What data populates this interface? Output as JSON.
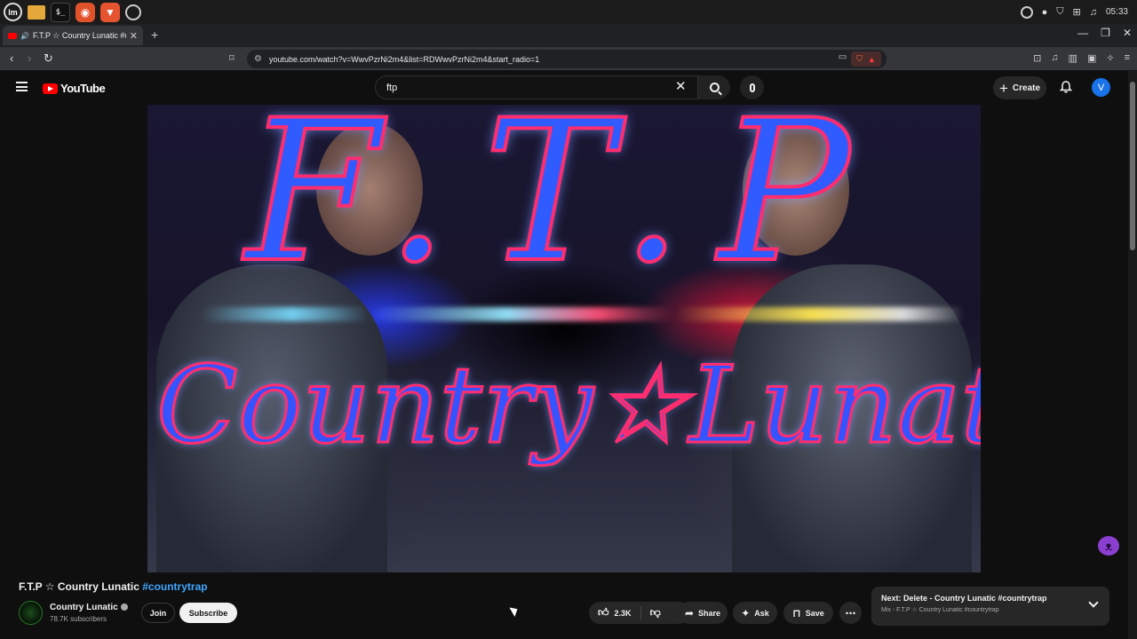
{
  "os_panel": {
    "launchers": [
      "mint-menu-icon",
      "files-icon",
      "terminal-icon",
      "firefox-icon",
      "brave-icon",
      "obs-icon"
    ],
    "clock": "05:33"
  },
  "browser": {
    "tab_title": "F.T.P ☆ Country Lunatic #c",
    "new_tab": "+",
    "url": "youtube.com/watch?v=WwvPzrNi2m4&list=RDWwvPzrNi2m4&start_radio=1"
  },
  "youtube": {
    "logo_text": "YouTube",
    "search_query": "ftp",
    "create_label": "Create",
    "avatar_letter": "V"
  },
  "video": {
    "title_main": "F.T.P ☆ Country Lunatic ",
    "title_tag": "#countrytrap",
    "thumbnail_text_top": "F.T.P",
    "thumbnail_text_bottom": "Country☆Lunatic"
  },
  "channel": {
    "name": "Country Lunatic",
    "subscribers": "78.7K subscribers",
    "join_label": "Join",
    "subscribe_label": "Subscribe"
  },
  "actions": {
    "likes": "2.3K",
    "share_label": "Share",
    "ask_label": "Ask",
    "save_label": "Save"
  },
  "next_up": {
    "title": "Next: Delete - Country Lunatic #countrytrap",
    "subtitle": "Mix - F.T.P ☆ Country Lunatic #countrytrap"
  },
  "colors": {
    "brand_red": "#ff0000",
    "accent_blue": "#3ea6ff",
    "background": "#0f0f0f"
  }
}
